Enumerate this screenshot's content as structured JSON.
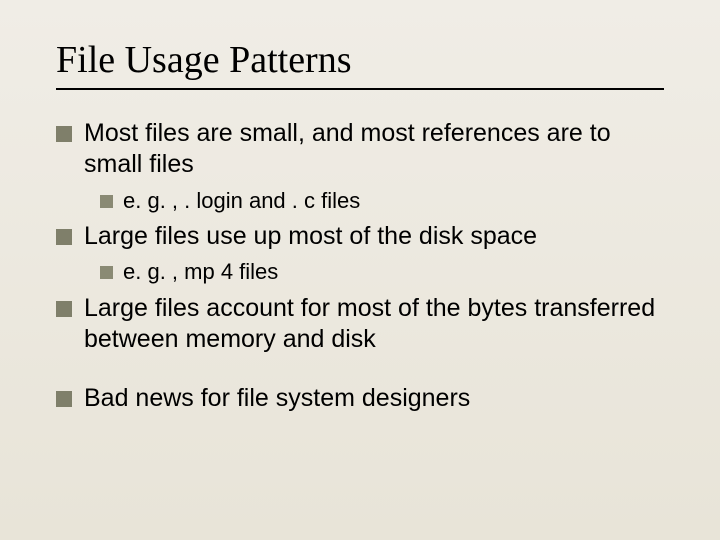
{
  "title": "File Usage Patterns",
  "bullets": {
    "b1": "Most files are small, and most references are to small files",
    "b1a": "e. g. , . login and . c files",
    "b2": "Large files use up most of the disk space",
    "b2a": "e. g. , mp 4 files",
    "b3": "Large files account for most of the bytes transferred between memory and disk",
    "b4": "Bad news for file system designers"
  }
}
